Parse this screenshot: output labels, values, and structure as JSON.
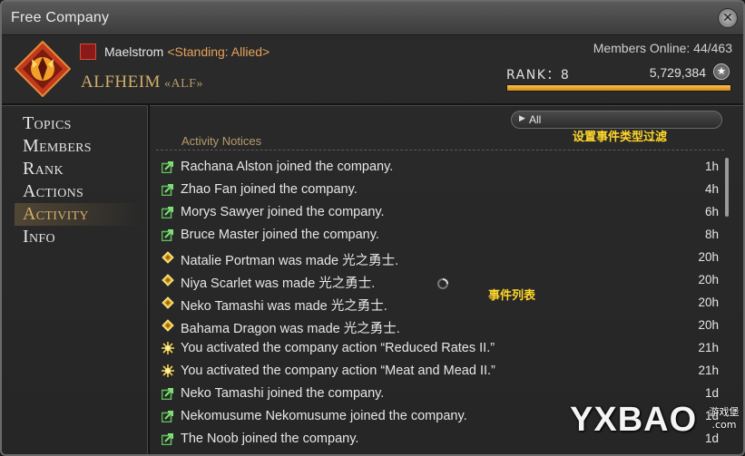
{
  "window": {
    "title": "Free Company"
  },
  "header": {
    "grand_company": "Maelstrom",
    "standing": "<Standing: Allied>",
    "fc_name": "ALFHEIM",
    "fc_tag": "«ALF»",
    "members_online": "Members Online: 44/463",
    "rank_label": "RANK：8",
    "rank_points": "5,729,384",
    "rank_progress": 1.0
  },
  "nav": {
    "items": [
      {
        "label": "Topics"
      },
      {
        "label": "Members"
      },
      {
        "label": "Rank"
      },
      {
        "label": "Actions"
      },
      {
        "label": "Activity"
      },
      {
        "label": "Info"
      }
    ],
    "active": "Activity"
  },
  "filter": {
    "label": "All"
  },
  "annotations": {
    "filter_note": "设置事件类型过滤",
    "list_note": "事件列表"
  },
  "section": {
    "title": "Activity Notices"
  },
  "activity": [
    {
      "icon": "join-icon",
      "text": "Rachana Alston joined the company.",
      "time": "1h"
    },
    {
      "icon": "join-icon",
      "text": "Zhao Fan joined the company.",
      "time": "4h"
    },
    {
      "icon": "join-icon",
      "text": "Morys Sawyer joined the company.",
      "time": "6h"
    },
    {
      "icon": "join-icon",
      "text": "Bruce Master joined the company.",
      "time": "8h"
    },
    {
      "icon": "promote-icon",
      "text": "Natalie Portman was made 光之勇士.",
      "time": "20h"
    },
    {
      "icon": "promote-icon",
      "text": "Niya Scarlet was made 光之勇士.",
      "time": "20h"
    },
    {
      "icon": "promote-icon",
      "text": "Neko Tamashi was made 光之勇士.",
      "time": "20h"
    },
    {
      "icon": "promote-icon",
      "text": "Bahama Dragon was made 光之勇士.",
      "time": "20h"
    },
    {
      "icon": "action-icon",
      "text": "You activated the company action “Reduced Rates II.”",
      "time": "21h"
    },
    {
      "icon": "action-icon",
      "text": "You activated the company action “Meat and Mead II.”",
      "time": "21h"
    },
    {
      "icon": "join-icon",
      "text": "Neko Tamashi joined the company.",
      "time": "1d"
    },
    {
      "icon": "join-icon",
      "text": "Nekomusume Nekomusume joined the company.",
      "time": "1d"
    },
    {
      "icon": "join-icon",
      "text": "The Noob joined the company.",
      "time": "1d"
    }
  ],
  "watermark": {
    "text": "YXBAO",
    "subtext": "游戏堡 .com"
  },
  "colors": {
    "accent_gold": "#d2ae6a",
    "rank_bar": "#ffc14a",
    "annotation": "#ffd62a",
    "join_icon": "#5fc05a",
    "promote_icon": "#f0c030"
  }
}
